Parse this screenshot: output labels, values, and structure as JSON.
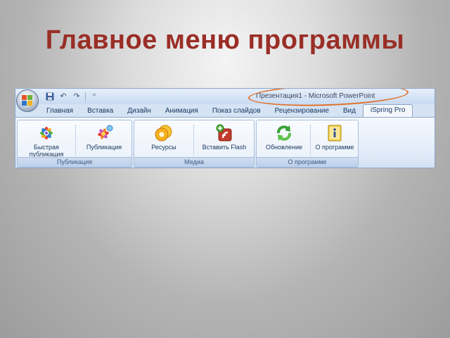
{
  "slide": {
    "title": "Главное меню программы"
  },
  "window": {
    "title": "Презентация1  -  Microsoft PowerPoint"
  },
  "quick_access": [
    {
      "name": "save-icon",
      "glyph": "▪"
    },
    {
      "name": "undo-icon",
      "glyph": "↶"
    },
    {
      "name": "redo-icon",
      "glyph": "↷"
    },
    {
      "name": "customize-icon",
      "glyph": "⁼"
    }
  ],
  "tabs": [
    {
      "label": "Главная",
      "active": false
    },
    {
      "label": "Вставка",
      "active": false
    },
    {
      "label": "Дизайн",
      "active": false
    },
    {
      "label": "Анимация",
      "active": false
    },
    {
      "label": "Показ слайдов",
      "active": false
    },
    {
      "label": "Рецензирование",
      "active": false
    },
    {
      "label": "Вид",
      "active": false
    },
    {
      "label": "iSpring Pro",
      "active": true
    }
  ],
  "groups": [
    {
      "label": "Публикация",
      "buttons": [
        {
          "label": "Быстрая\nпубликация",
          "icon": "quick-publish-icon"
        },
        {
          "label": "Публикация",
          "icon": "publish-icon"
        }
      ]
    },
    {
      "label": "Медиа",
      "buttons": [
        {
          "label": "Ресурсы",
          "icon": "resources-icon"
        },
        {
          "label": "Вставить Flash",
          "icon": "insert-flash-icon"
        }
      ]
    },
    {
      "label": "О программе",
      "buttons": [
        {
          "label": "Обновление",
          "icon": "update-icon"
        },
        {
          "label": "О программе",
          "icon": "about-icon"
        }
      ]
    }
  ],
  "colors": {
    "title_red": "#9a2e26",
    "annotation_orange": "#e07028",
    "ribbon_blue": "#d5e3f5"
  }
}
